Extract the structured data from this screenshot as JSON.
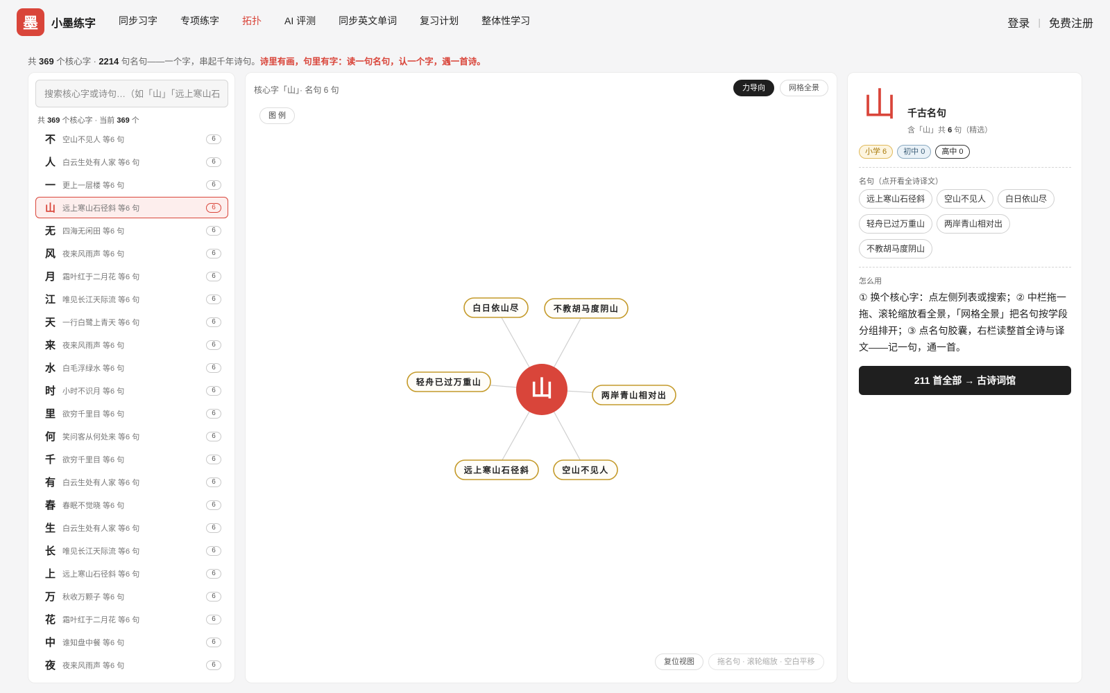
{
  "header": {
    "logo_char": "墨",
    "brand": "小墨练字",
    "nav": [
      {
        "label": "同步习字",
        "active": false
      },
      {
        "label": "专项练字",
        "active": false
      },
      {
        "label": "拓扑",
        "active": true
      },
      {
        "label": "AI 评测",
        "active": false
      },
      {
        "label": "同步英文单词",
        "active": false
      },
      {
        "label": "复习计划",
        "active": false
      },
      {
        "label": "整体性学习",
        "active": false
      }
    ],
    "login": "登录",
    "separator": "|",
    "register": "免费注册"
  },
  "stats": {
    "prefix": "共",
    "chars": "369",
    "mid1": "个核心字 ·",
    "lines": "2214",
    "mid2": "句名句——一个字，串起千年诗句。",
    "highlight": "诗里有画，句里有字：读一句名句，认一个字，遇一首诗。"
  },
  "left": {
    "search_placeholder": "搜索核心字或诗句…（如「山」「远上寒山石径斜」）",
    "count_prefix": "共",
    "count_total": "369",
    "count_mid": "个核心字 · 当前",
    "count_current": "369",
    "count_suffix": "个",
    "items": [
      {
        "char": "不",
        "sample": "空山不见人 等6 句",
        "count": "6"
      },
      {
        "char": "人",
        "sample": "白云生处有人家 等6 句",
        "count": "6"
      },
      {
        "char": "一",
        "sample": "更上一层楼 等6 句",
        "count": "6"
      },
      {
        "char": "山",
        "sample": "远上寒山石径斜 等6 句",
        "count": "6",
        "active": true
      },
      {
        "char": "无",
        "sample": "四海无闲田 等6 句",
        "count": "6"
      },
      {
        "char": "风",
        "sample": "夜来风雨声 等6 句",
        "count": "6"
      },
      {
        "char": "月",
        "sample": "霜叶红于二月花 等6 句",
        "count": "6"
      },
      {
        "char": "江",
        "sample": "唯见长江天际流 等6 句",
        "count": "6"
      },
      {
        "char": "天",
        "sample": "一行白鹭上青天 等6 句",
        "count": "6"
      },
      {
        "char": "来",
        "sample": "夜来风雨声 等6 句",
        "count": "6"
      },
      {
        "char": "水",
        "sample": "白毛浮绿水 等6 句",
        "count": "6"
      },
      {
        "char": "时",
        "sample": "小时不识月 等6 句",
        "count": "6"
      },
      {
        "char": "里",
        "sample": "欲穷千里目 等6 句",
        "count": "6"
      },
      {
        "char": "何",
        "sample": "笑问客从何处来 等6 句",
        "count": "6"
      },
      {
        "char": "千",
        "sample": "欲穷千里目 等6 句",
        "count": "6"
      },
      {
        "char": "有",
        "sample": "白云生处有人家 等6 句",
        "count": "6"
      },
      {
        "char": "春",
        "sample": "春眠不觉晓 等6 句",
        "count": "6"
      },
      {
        "char": "生",
        "sample": "白云生处有人家 等6 句",
        "count": "6"
      },
      {
        "char": "长",
        "sample": "唯见长江天际流 等6 句",
        "count": "6"
      },
      {
        "char": "上",
        "sample": "远上寒山石径斜 等6 句",
        "count": "6"
      },
      {
        "char": "万",
        "sample": "秋收万颗子 等6 句",
        "count": "6"
      },
      {
        "char": "花",
        "sample": "霜叶红于二月花 等6 句",
        "count": "6"
      },
      {
        "char": "中",
        "sample": "谁知盘中餐 等6 句",
        "count": "6"
      },
      {
        "char": "夜",
        "sample": "夜来风雨声 等6 句",
        "count": "6"
      }
    ]
  },
  "center": {
    "title": "核心字「山」· 名句 6 句",
    "mode_force": "力导向",
    "mode_grid": "网格全景",
    "legend": "图 例",
    "center_char": "山",
    "nodes": [
      {
        "text": "白日依山尽"
      },
      {
        "text": "不教胡马度阴山"
      },
      {
        "text": "轻舟已过万重山"
      },
      {
        "text": "两岸青山相对出"
      },
      {
        "text": "远上寒山石径斜"
      },
      {
        "text": "空山不见人"
      }
    ],
    "reset": "复位视图",
    "hint": "拖名句 · 滚轮缩放 · 空白平移",
    "colors": {
      "center": "#d9453a",
      "pill_border": "#c49a2a",
      "edge": "#cfcfcf"
    }
  },
  "right": {
    "char": "山",
    "title": "千古名句",
    "sub_prefix": "含「山」共",
    "sub_count": "6",
    "sub_suffix": "句（精选）",
    "levels": [
      {
        "label": "小学 6",
        "kind": "p"
      },
      {
        "label": "初中 0",
        "kind": "m"
      },
      {
        "label": "高中 0",
        "kind": "h"
      }
    ],
    "lines_label": "名句（点开看全诗译文）",
    "lines": [
      "远上寒山石径斜",
      "空山不见人",
      "白日依山尽",
      "轻舟已过万重山",
      "两岸青山相对出",
      "不教胡马度阴山"
    ],
    "howto_label": "怎么用",
    "howto": "① 换个核心字：点左侧列表或搜索；② 中栏拖一拖、滚轮缩放看全景，「网格全景」把名句按学段分组排开；③ 点名句胶囊，右栏读整首全诗与译文——记一句，通一首。",
    "cta": "211 首全部 → 古诗词馆"
  }
}
